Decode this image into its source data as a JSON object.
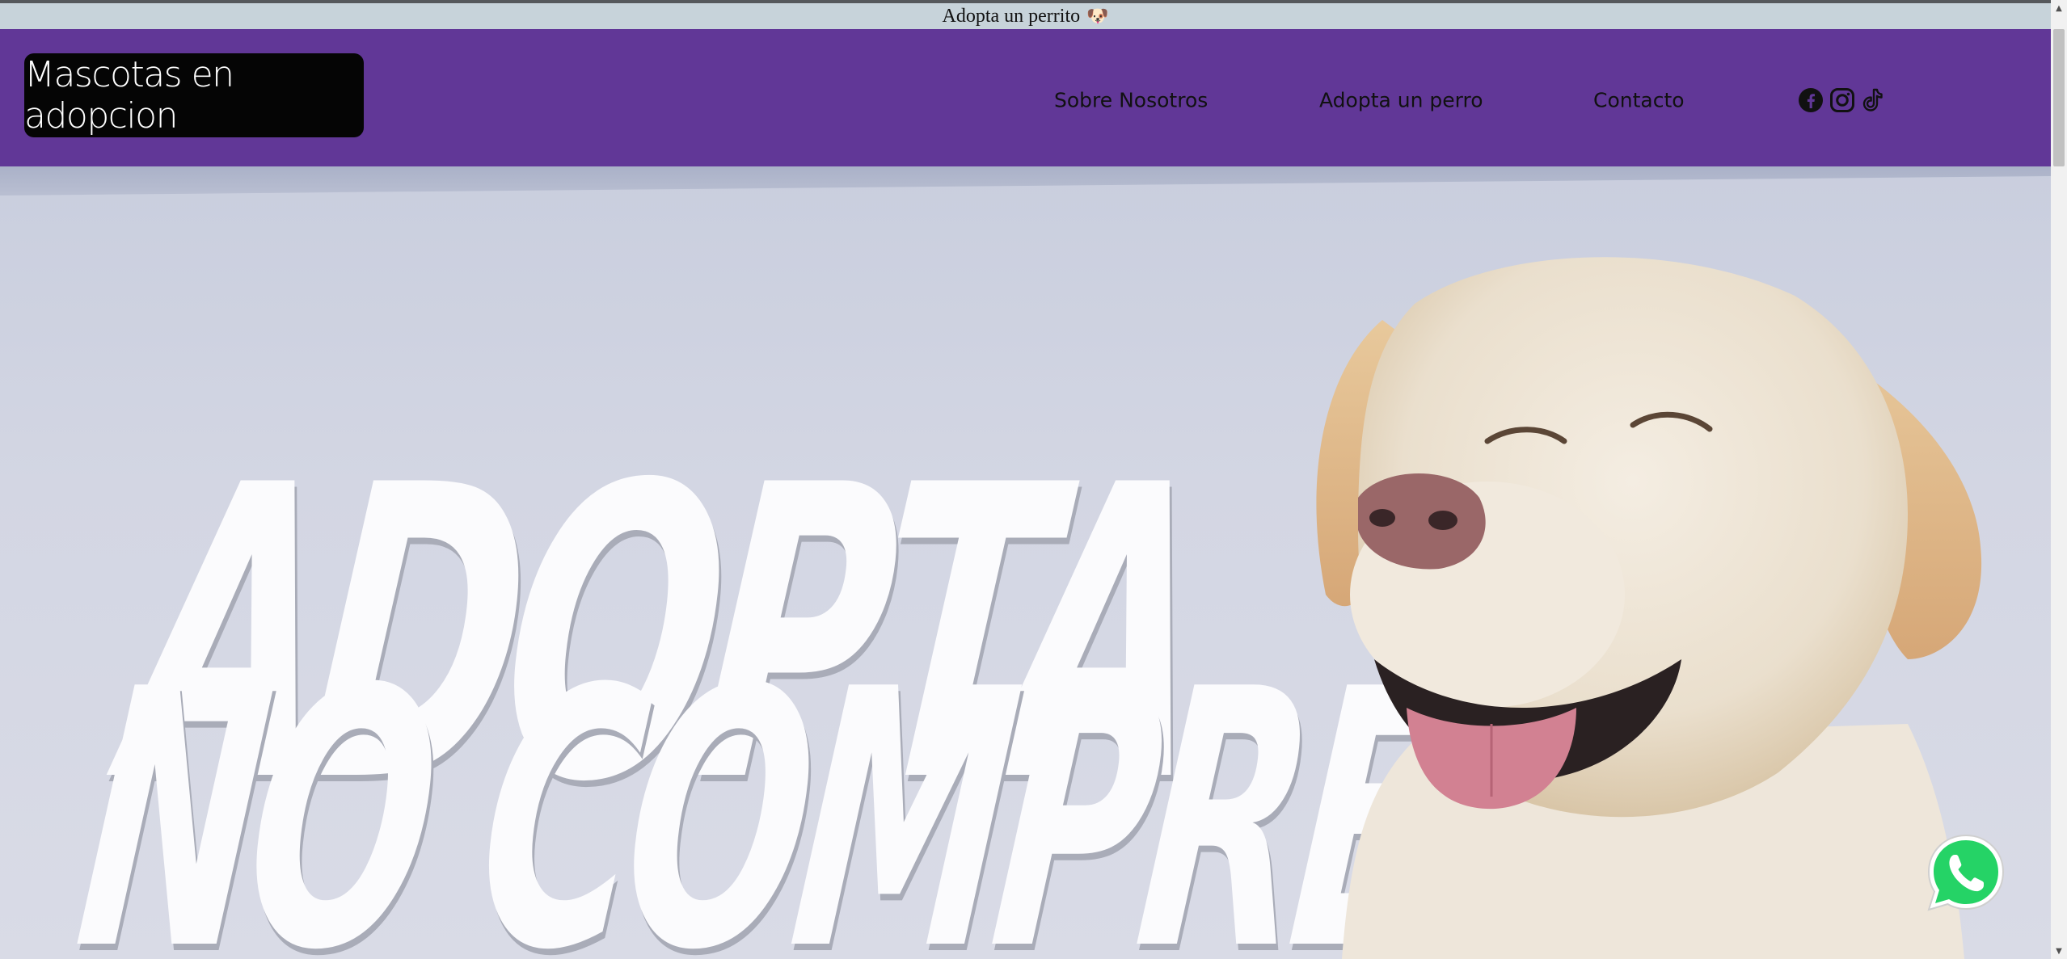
{
  "titlebar": {
    "text": "Adopta un perrito",
    "emoji": "🐶"
  },
  "header": {
    "logo": "Mascotas en adopcion",
    "nav": [
      {
        "label": "Sobre Nosotros"
      },
      {
        "label": "Adopta un perro"
      },
      {
        "label": "Contacto"
      }
    ],
    "social": [
      "facebook-icon",
      "instagram-icon",
      "tiktok-icon"
    ]
  },
  "hero": {
    "line1": "ADOPTA",
    "line2": "NO COMPRES"
  },
  "colors": {
    "header_bg": "#613797",
    "logo_bg": "#050505",
    "whatsapp": "#25d366"
  }
}
